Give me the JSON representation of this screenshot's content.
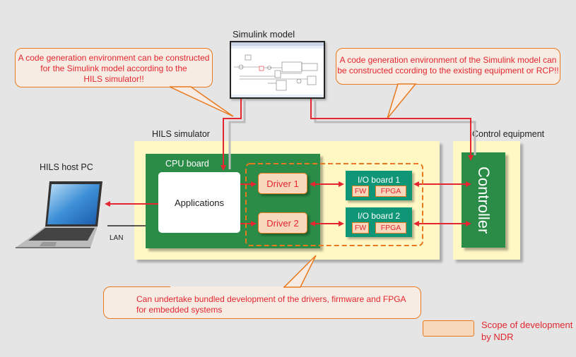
{
  "simulink": {
    "title": "Simulink model"
  },
  "callouts": {
    "left": [
      "A code generation environment can be constructed",
      "for the Simulink model according to the",
      "HILS simulator!!"
    ],
    "right": [
      "A code generation environment of the Simulink model can",
      "be  constructed ccording to the existing equipment or RCP!!"
    ],
    "bottom": [
      "Can undertake bundled development of the drivers, firmware and FPGA",
      "for embedded systems"
    ]
  },
  "hils_simulator": {
    "label": "HILS simulator"
  },
  "cpu_board": {
    "label": "CPU board",
    "applications": "Applications"
  },
  "drivers": [
    "Driver 1",
    "Driver 2"
  ],
  "io_boards": [
    {
      "label": "I/O board 1",
      "fw": "FW",
      "fpga": "FPGA"
    },
    {
      "label": "I/O board 2",
      "fw": "FW",
      "fpga": "FPGA"
    }
  ],
  "control_equipment": {
    "label": "Control equipment",
    "controller": "Controller"
  },
  "host_pc": {
    "label": "HILS host PC",
    "lan": "LAN"
  },
  "legend": {
    "label_line1": "Scope of development",
    "label_line2": "by NDR"
  },
  "colors": {
    "accent_red": "#e3262f",
    "orange": "#e8791e",
    "green": "#2a8c47",
    "teal": "#0f9677",
    "yellow": "#fff8c4"
  }
}
